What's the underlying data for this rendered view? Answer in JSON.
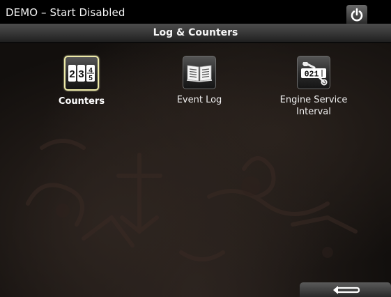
{
  "status_bar": {
    "text": "DEMO – Start Disabled",
    "power_icon": "power-icon"
  },
  "header": {
    "title": "Log & Counters"
  },
  "tiles": [
    {
      "label": "Counters",
      "icon": "counters-icon",
      "selected": true,
      "digits": [
        "2",
        "3",
        "4",
        "5"
      ]
    },
    {
      "label": "Event Log",
      "icon": "book-icon",
      "selected": false
    },
    {
      "label": "Engine Service Interval",
      "icon": "wrench-counter-icon",
      "selected": false,
      "digits": "021"
    }
  ],
  "footer": {
    "back_icon": "back-arrow-icon"
  },
  "colors": {
    "selection_border": "#ece9a7",
    "bar_background": "#000000"
  }
}
